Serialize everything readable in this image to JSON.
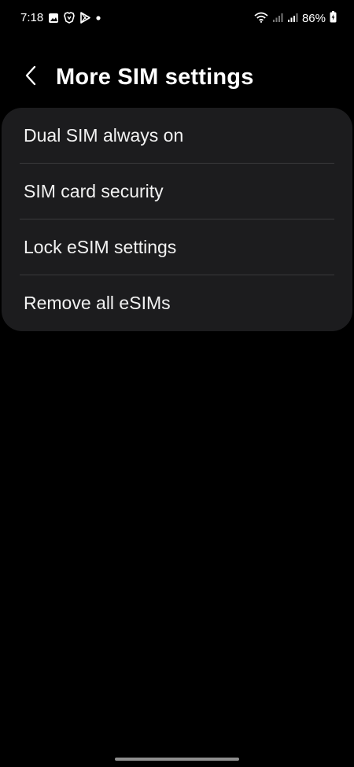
{
  "status_bar": {
    "time": "7:18",
    "battery_percent": "86%",
    "left_icons": [
      "gallery-icon",
      "brave-icon",
      "play-store-icon",
      "notification-dot-icon"
    ],
    "right_icons": [
      "wifi-icon",
      "signal-icon-1",
      "signal-icon-2",
      "battery-charging-icon"
    ]
  },
  "header": {
    "title": "More SIM settings",
    "back_icon": "chevron-left-icon"
  },
  "settings": {
    "items": [
      {
        "label": "Dual SIM always on"
      },
      {
        "label": "SIM card security"
      },
      {
        "label": "Lock eSIM settings"
      },
      {
        "label": "Remove all eSIMs"
      }
    ]
  },
  "colors": {
    "background": "#000000",
    "card": "#1c1c1e",
    "divider": "#3a3a3c",
    "text": "#ffffff"
  }
}
